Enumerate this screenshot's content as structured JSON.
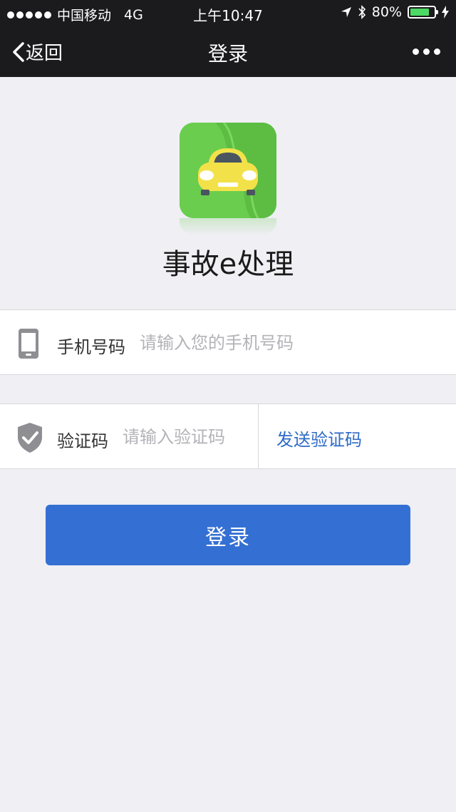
{
  "status_bar": {
    "carrier": "中国移动",
    "network": "4G",
    "time": "上午10:47",
    "battery": "80%",
    "battery_level": 0.8
  },
  "nav": {
    "back_label": "返回",
    "title": "登录"
  },
  "app": {
    "name": "事故e处理",
    "logo_color": "#6acd4e"
  },
  "form": {
    "phone_label": "手机号码",
    "phone_placeholder": "请输入您的手机号码",
    "code_label": "验证码",
    "code_placeholder": "请输入验证码",
    "send_code_label": "发送验证码"
  },
  "login_button_label": "登录",
  "colors": {
    "accent": "#3470d3",
    "link": "#2e6ac8",
    "nav_background": "#1b1b1d"
  }
}
